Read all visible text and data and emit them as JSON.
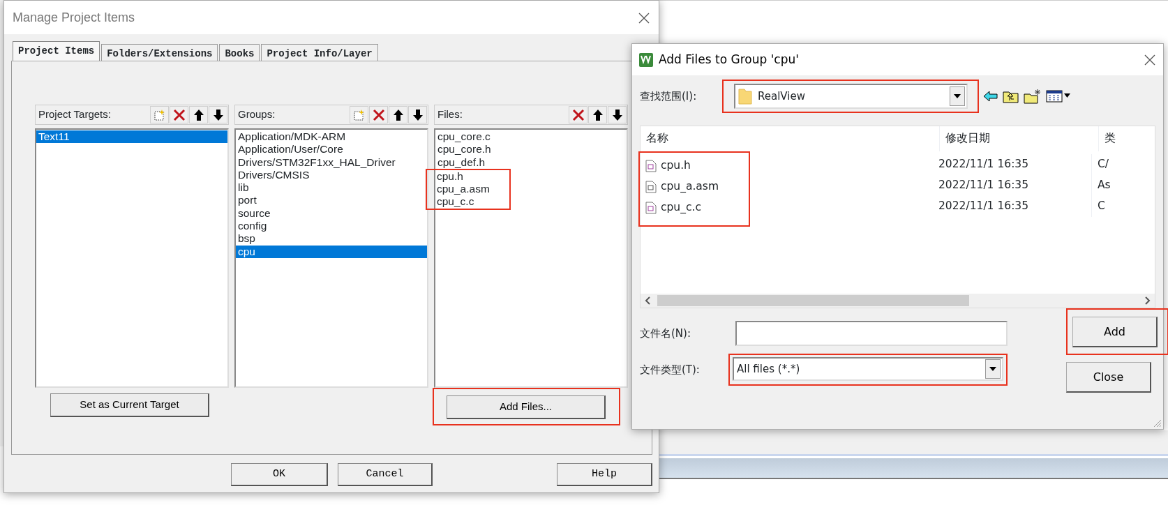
{
  "manage_dialog": {
    "title": "Manage Project Items",
    "tabs": [
      {
        "label": "Project Items",
        "selected": true
      },
      {
        "label": "Folders/Extensions",
        "selected": false
      },
      {
        "label": "Books",
        "selected": false
      },
      {
        "label": "Project Info/Layer",
        "selected": false
      }
    ],
    "panels": [
      {
        "label": "Project Targets:",
        "tools": [
          {
            "kind": "new"
          },
          {
            "kind": "delete"
          },
          {
            "kind": "up"
          },
          {
            "kind": "down"
          }
        ],
        "items": [
          {
            "text": "Text11",
            "selected": true,
            "highlighted": false
          }
        ]
      },
      {
        "label": "Groups:",
        "tools": [
          {
            "kind": "new"
          },
          {
            "kind": "delete"
          },
          {
            "kind": "up"
          },
          {
            "kind": "down"
          }
        ],
        "items": [
          {
            "text": "Application/MDK-ARM",
            "selected": false,
            "highlighted": false
          },
          {
            "text": "Application/User/Core",
            "selected": false,
            "highlighted": false
          },
          {
            "text": "Drivers/STM32F1xx_HAL_Driver",
            "selected": false,
            "highlighted": false
          },
          {
            "text": "Drivers/CMSIS",
            "selected": false,
            "highlighted": false
          },
          {
            "text": "lib",
            "selected": false,
            "highlighted": false
          },
          {
            "text": "port",
            "selected": false,
            "highlighted": false
          },
          {
            "text": "source",
            "selected": false,
            "highlighted": false
          },
          {
            "text": "config",
            "selected": false,
            "highlighted": false
          },
          {
            "text": "bsp",
            "selected": false,
            "highlighted": false
          },
          {
            "text": "cpu",
            "selected": true,
            "highlighted": false
          }
        ]
      },
      {
        "label": "Files:",
        "tools": [
          {
            "kind": "delete"
          },
          {
            "kind": "up"
          },
          {
            "kind": "down"
          }
        ],
        "items": [
          {
            "text": "cpu_core.c",
            "selected": false,
            "highlighted": false
          },
          {
            "text": "cpu_core.h",
            "selected": false,
            "highlighted": false
          },
          {
            "text": "cpu_def.h",
            "selected": false,
            "highlighted": false
          },
          {
            "text": "cpu.h",
            "selected": false,
            "highlighted": true
          },
          {
            "text": "cpu_a.asm",
            "selected": false,
            "highlighted": true
          },
          {
            "text": "cpu_c.c",
            "selected": false,
            "highlighted": true
          }
        ]
      }
    ],
    "panel_buttons": [
      {
        "label": "Set as Current Target",
        "highlighted": false
      },
      {
        "label": "Add Files...",
        "highlighted": true
      }
    ],
    "buttons": [
      {
        "label": "OK"
      },
      {
        "label": "Cancel"
      },
      {
        "label": "Help"
      }
    ]
  },
  "add_dialog": {
    "title": "Add Files to Group 'cpu'",
    "look_in_label": "查找范围(I):",
    "look_in": {
      "value": "RealView",
      "highlighted": true
    },
    "tools": [
      {
        "kind": "back"
      },
      {
        "kind": "up-folder"
      },
      {
        "kind": "new-folder"
      },
      {
        "kind": "view-menu"
      }
    ],
    "columns": [
      "名称",
      "修改日期",
      "类"
    ],
    "rows": [
      {
        "kind": "header",
        "name": "cpu.h",
        "date": "2022/11/1 16:35",
        "type": "C/",
        "highlighted": true
      },
      {
        "kind": "asm",
        "name": "cpu_a.asm",
        "date": "2022/11/1 16:35",
        "type": "As",
        "highlighted": true
      },
      {
        "kind": "source",
        "name": "cpu_c.c",
        "date": "2022/11/1 16:35",
        "type": "C",
        "highlighted": true
      }
    ],
    "file_name_label": "文件名(N):",
    "file_type_label": "文件类型(T):",
    "file_type": {
      "value": "All files (*.*)",
      "highlighted": true
    },
    "buttons": [
      {
        "label": "Add",
        "highlighted": true
      },
      {
        "label": "Close",
        "highlighted": false
      }
    ]
  }
}
